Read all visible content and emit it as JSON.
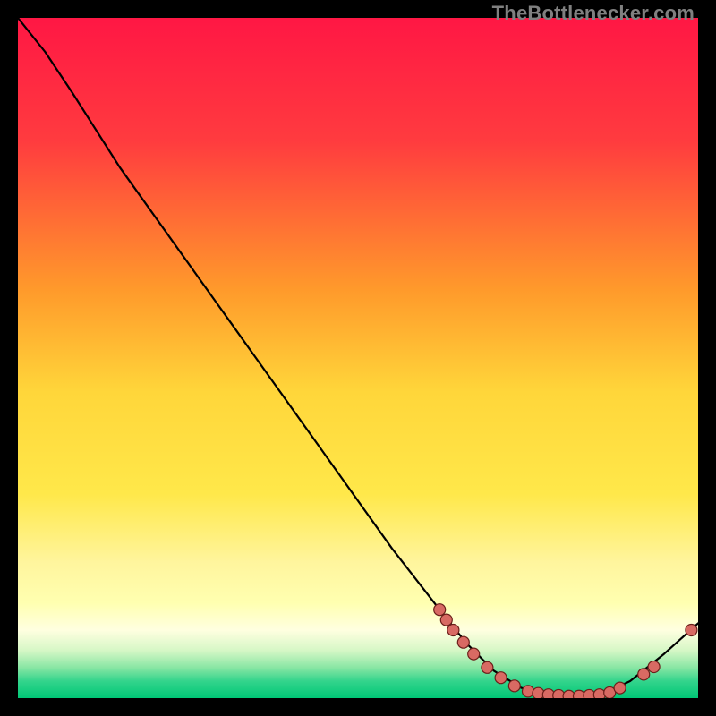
{
  "watermark": "TheBottlenecker.com",
  "chart_data": {
    "type": "line",
    "xlabel": "",
    "ylabel": "",
    "title": "",
    "xlim": [
      0,
      100
    ],
    "ylim": [
      0,
      100
    ],
    "gradient_stops": [
      {
        "offset": 0.0,
        "color": "#ff1744"
      },
      {
        "offset": 0.18,
        "color": "#ff3b3f"
      },
      {
        "offset": 0.4,
        "color": "#ff9a2b"
      },
      {
        "offset": 0.55,
        "color": "#ffd63a"
      },
      {
        "offset": 0.7,
        "color": "#ffe84a"
      },
      {
        "offset": 0.8,
        "color": "#fff59d"
      },
      {
        "offset": 0.86,
        "color": "#ffffb0"
      },
      {
        "offset": 0.9,
        "color": "#ffffe0"
      },
      {
        "offset": 0.93,
        "color": "#d6f7c6"
      },
      {
        "offset": 0.955,
        "color": "#89e6a4"
      },
      {
        "offset": 0.975,
        "color": "#33d48c"
      },
      {
        "offset": 1.0,
        "color": "#00c776"
      }
    ],
    "curve": [
      {
        "x": 0.0,
        "y": 100.0
      },
      {
        "x": 4.0,
        "y": 95.0
      },
      {
        "x": 8.0,
        "y": 89.0
      },
      {
        "x": 15.0,
        "y": 78.0
      },
      {
        "x": 25.0,
        "y": 64.0
      },
      {
        "x": 35.0,
        "y": 50.0
      },
      {
        "x": 45.0,
        "y": 36.0
      },
      {
        "x": 55.0,
        "y": 22.0
      },
      {
        "x": 62.0,
        "y": 13.0
      },
      {
        "x": 66.0,
        "y": 8.0
      },
      {
        "x": 70.0,
        "y": 4.0
      },
      {
        "x": 74.0,
        "y": 1.5
      },
      {
        "x": 78.0,
        "y": 0.5
      },
      {
        "x": 82.0,
        "y": 0.3
      },
      {
        "x": 86.0,
        "y": 0.6
      },
      {
        "x": 90.0,
        "y": 2.5
      },
      {
        "x": 95.0,
        "y": 6.5
      },
      {
        "x": 100.0,
        "y": 11.0
      }
    ],
    "markers": [
      {
        "x": 62.0,
        "y": 13.0
      },
      {
        "x": 63.0,
        "y": 11.5
      },
      {
        "x": 64.0,
        "y": 10.0
      },
      {
        "x": 65.5,
        "y": 8.2
      },
      {
        "x": 67.0,
        "y": 6.5
      },
      {
        "x": 69.0,
        "y": 4.5
      },
      {
        "x": 71.0,
        "y": 3.0
      },
      {
        "x": 73.0,
        "y": 1.8
      },
      {
        "x": 75.0,
        "y": 1.0
      },
      {
        "x": 76.5,
        "y": 0.7
      },
      {
        "x": 78.0,
        "y": 0.5
      },
      {
        "x": 79.5,
        "y": 0.4
      },
      {
        "x": 81.0,
        "y": 0.3
      },
      {
        "x": 82.5,
        "y": 0.3
      },
      {
        "x": 84.0,
        "y": 0.4
      },
      {
        "x": 85.5,
        "y": 0.5
      },
      {
        "x": 87.0,
        "y": 0.8
      },
      {
        "x": 88.5,
        "y": 1.5
      },
      {
        "x": 92.0,
        "y": 3.5
      },
      {
        "x": 93.5,
        "y": 4.6
      },
      {
        "x": 99.0,
        "y": 10.0
      }
    ],
    "marker_style": {
      "fill": "#d86a63",
      "stroke": "#6b1f1a",
      "r": 6.5
    },
    "line_style": {
      "stroke": "#000000",
      "width": 2.2
    }
  }
}
